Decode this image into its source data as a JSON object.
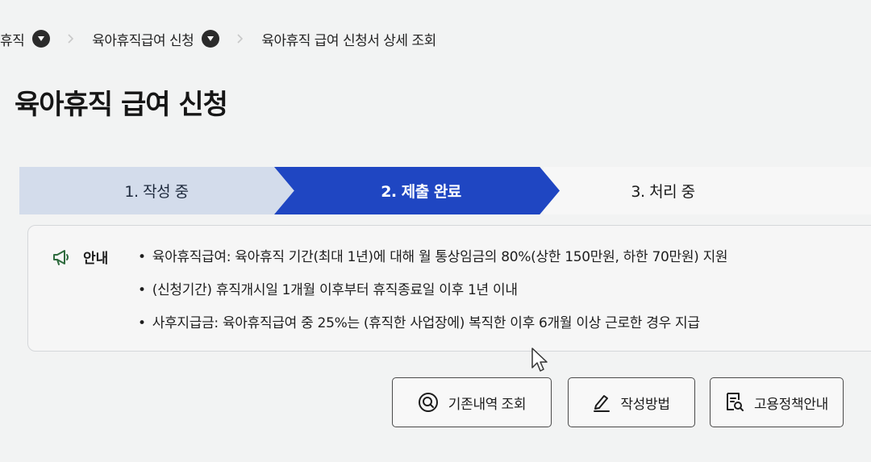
{
  "breadcrumb": {
    "items": [
      {
        "label": "휴직"
      },
      {
        "label": "육아휴직급여 신청"
      },
      {
        "label": "육아휴직 급여 신청서 상세 조회"
      }
    ]
  },
  "page": {
    "title": "육아휴직 급여 신청"
  },
  "steps": [
    {
      "label": "1. 작성 중",
      "state": "done"
    },
    {
      "label": "2. 제출 완료",
      "state": "current"
    },
    {
      "label": "3. 처리 중",
      "state": "pending"
    }
  ],
  "notice": {
    "icon": "megaphone-icon",
    "label": "안내",
    "items": [
      "육아휴직급여: 육아휴직 기간(최대 1년)에 대해 월 통상임금의 80%(상한 150만원, 하한 70만원) 지원",
      "(신청기간) 휴직개시일 1개월 이후부터 휴직종료일 이후 1년 이내",
      "사후지급금: 육아휴직급여 중 25%는 (휴직한 사업장에) 복직한 이후 6개월 이상 근로한 경우 지급"
    ]
  },
  "buttons": {
    "history": {
      "label": "기존내역 조회",
      "icon": "search-icon"
    },
    "guide": {
      "label": "작성방법",
      "icon": "pencil-icon"
    },
    "policy": {
      "label": "고용정책안내",
      "icon": "document-search-icon"
    }
  },
  "colors": {
    "accent": "#1f46c2",
    "step_done": "#d3dceb",
    "background": "#f2f3f3"
  }
}
